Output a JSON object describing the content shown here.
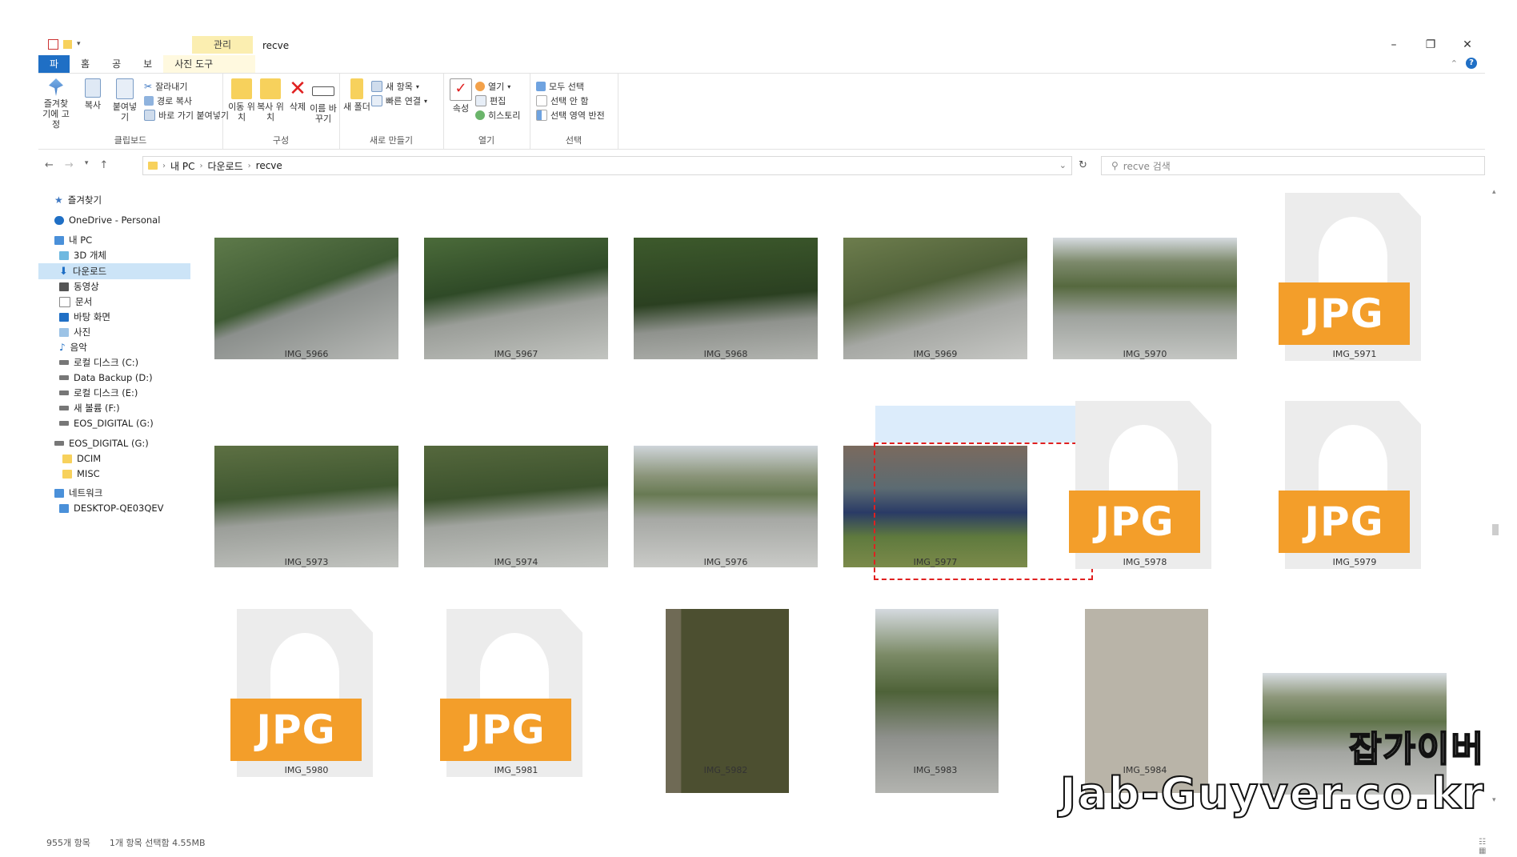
{
  "window": {
    "title": "recve",
    "context_tab": "관리",
    "controls": [
      "–",
      "❐",
      "✕"
    ]
  },
  "tabs": [
    {
      "label": "파일"
    },
    {
      "label": "홈"
    },
    {
      "label": "공유"
    },
    {
      "label": "보기"
    },
    {
      "label": "사진 도구"
    }
  ],
  "ribbon": {
    "clipboard": {
      "label": "클립보드",
      "pin": "즐겨찾기에 고정",
      "copy": "복사",
      "paste": "붙여넣기",
      "cut": "잘라내기",
      "copy_path": "경로 복사",
      "paste_shortcut": "바로 가기 붙여넣기"
    },
    "organize": {
      "label": "구성",
      "move": "이동 위치",
      "copyto": "복사 위치",
      "delete": "삭제",
      "rename": "이름 바꾸기"
    },
    "new": {
      "label": "새로 만들기",
      "new_folder": "새 폴더",
      "new_item": "새 항목",
      "easy_access": "빠른 연결"
    },
    "open": {
      "label": "열기",
      "properties": "속성",
      "open": "열기",
      "edit": "편집",
      "history": "히스토리"
    },
    "select": {
      "label": "선택",
      "select_all": "모두 선택",
      "select_none": "선택 안 함",
      "invert": "선택 영역 반전"
    }
  },
  "address": {
    "crumbs": [
      "내 PC",
      "다운로드",
      "recve"
    ],
    "search_placeholder": "recve 검색"
  },
  "nav": {
    "favorites": "즐겨찾기",
    "onedrive": "OneDrive - Personal",
    "thispc": "내 PC",
    "items": [
      "3D 개체",
      "다운로드",
      "동영상",
      "문서",
      "바탕 화면",
      "사진",
      "음악",
      "로컬 디스크 (C:)",
      "Data Backup (D:)",
      "로컬 디스크 (E:)",
      "새 볼륨 (F:)",
      "EOS_DIGITAL (G:)"
    ],
    "eos": "EOS_DIGITAL (G:)",
    "eos_children": [
      "DCIM",
      "MISC"
    ],
    "network": "네트워크",
    "desktop": "DESKTOP-QE03QEV"
  },
  "files": {
    "row1": [
      "IMG_5966",
      "IMG_5967",
      "IMG_5968",
      "IMG_5969",
      "IMG_5970",
      "IMG_5971"
    ],
    "row2": [
      "IMG_5973",
      "IMG_5974",
      "IMG_5976",
      "IMG_5977",
      "IMG_5978",
      "IMG_5979"
    ],
    "row3": [
      "IMG_5980",
      "IMG_5981",
      "IMG_5982",
      "IMG_5983",
      "IMG_5984"
    ],
    "jpg_label": "JPG"
  },
  "status": {
    "count": "955개 항목",
    "selection": "1개 항목 선택함 4.55MB"
  },
  "watermark": {
    "line1": "잡가이버",
    "line2": "Jab-Guyver.co.kr"
  },
  "colors": {
    "accent": "#1f6fc5",
    "jpg_badge": "#f39e2a",
    "selection": "#e02020"
  }
}
